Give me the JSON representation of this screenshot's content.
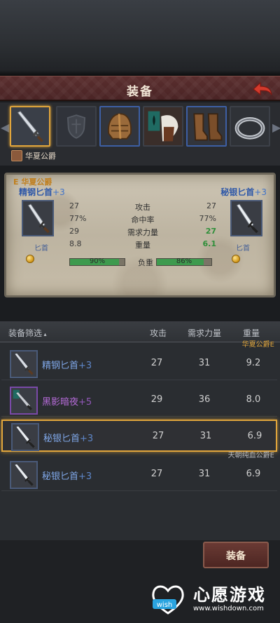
{
  "header": {
    "title": "装备"
  },
  "owner": {
    "name": "华夏公爵"
  },
  "comparison": {
    "guild": "E 华夏公爵",
    "left": {
      "name": "精钢匕首",
      "plus": "+3",
      "type": "匕首"
    },
    "right": {
      "name": "秘银匕首",
      "plus": "+3",
      "type": "匕首"
    },
    "stats": [
      {
        "label": "攻击",
        "left": "27",
        "right": "27",
        "right_green": false
      },
      {
        "label": "命中率",
        "left": "77%",
        "right": "77%",
        "right_green": false
      },
      {
        "label": "需求力量",
        "left": "29",
        "right": "27",
        "right_green": true
      },
      {
        "label": "重量",
        "left": "8.8",
        "right": "6.1",
        "right_green": true
      }
    ],
    "load": {
      "label": "负重",
      "left_pct": 90,
      "left_text": "90%",
      "right_pct": 86,
      "right_text": "86%"
    }
  },
  "list": {
    "headers": {
      "filter": "装备筛选",
      "attack": "攻击",
      "strength": "需求力量",
      "weight": "重量"
    },
    "rows": [
      {
        "name": "精钢匕首",
        "plus": "+3",
        "attack": "27",
        "strength": "31",
        "weight": "9.2",
        "tag": "华夏公爵E",
        "tag_style": "gold"
      },
      {
        "name": "黑影暗夜",
        "plus": "+5",
        "attack": "29",
        "strength": "36",
        "weight": "8.0",
        "tag": "",
        "tag_style": ""
      },
      {
        "name": "秘银匕首",
        "plus": "+3",
        "attack": "27",
        "strength": "31",
        "weight": "6.9",
        "tag": "",
        "tag_style": ""
      },
      {
        "name": "秘银匕首",
        "plus": "+3",
        "attack": "27",
        "strength": "31",
        "weight": "6.9",
        "tag": "天朝纯血公爵E",
        "tag_style": "grey"
      }
    ]
  },
  "footer": {
    "equip_label": "装备"
  },
  "watermark": {
    "title": "心愿游戏",
    "url": "www.wishdown.com",
    "logo_text": "wish"
  },
  "colors": {
    "accent_gold": "#e0a53c",
    "title_bar": "#5a2e2e",
    "positive": "#2f8f3a"
  },
  "icons": [
    "dagger-icon",
    "shield-icon",
    "helmet-icon",
    "banner-icon",
    "boots-icon",
    "ring-icon",
    "back-arrow-icon",
    "coin-icon"
  ]
}
